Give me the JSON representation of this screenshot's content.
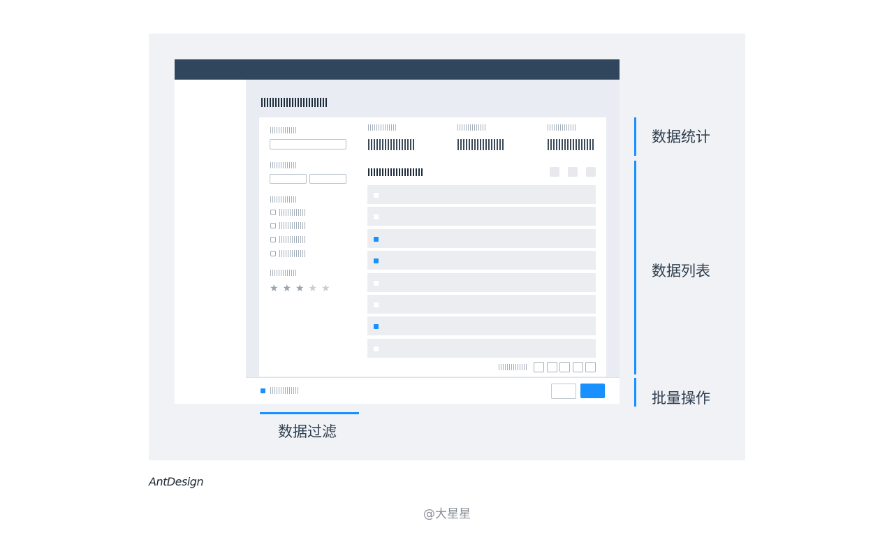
{
  "annotations": {
    "stats": "数据统计",
    "list": "数据列表",
    "batch": "批量操作",
    "filter": "数据过滤"
  },
  "brand": "AntDesign",
  "credit": "@大星星",
  "mockup": {
    "rating": {
      "value": 3,
      "max": 5
    },
    "list_rows_selected": [
      false,
      false,
      true,
      true,
      false,
      false,
      true,
      false
    ],
    "pagination_pages": 5
  },
  "colors": {
    "accent": "#1890ff",
    "header": "#30465c",
    "panel": "#f0f2f5"
  }
}
